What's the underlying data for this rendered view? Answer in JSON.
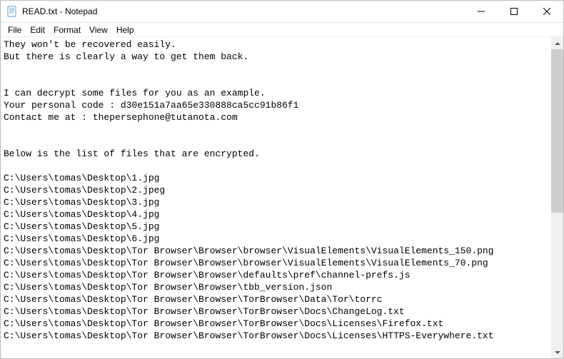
{
  "window": {
    "title": "READ.txt - Notepad"
  },
  "menubar": {
    "file": "File",
    "edit": "Edit",
    "format": "Format",
    "view": "View",
    "help": "Help"
  },
  "content": {
    "text": "They won't be recovered easily.\nBut there is clearly a way to get them back.\n\n\nI can decrypt some files for you as an example.\nYour personal code : d30e151a7aa65e330888ca5cc91b86f1\nContact me at : thepersephone@tutanota.com\n\n\nBelow is the list of files that are encrypted.\n\nC:\\Users\\tomas\\Desktop\\1.jpg\nC:\\Users\\tomas\\Desktop\\2.jpeg\nC:\\Users\\tomas\\Desktop\\3.jpg\nC:\\Users\\tomas\\Desktop\\4.jpg\nC:\\Users\\tomas\\Desktop\\5.jpg\nC:\\Users\\tomas\\Desktop\\6.jpg\nC:\\Users\\tomas\\Desktop\\Tor Browser\\Browser\\browser\\VisualElements\\VisualElements_150.png\nC:\\Users\\tomas\\Desktop\\Tor Browser\\Browser\\browser\\VisualElements\\VisualElements_70.png\nC:\\Users\\tomas\\Desktop\\Tor Browser\\Browser\\defaults\\pref\\channel-prefs.js\nC:\\Users\\tomas\\Desktop\\Tor Browser\\Browser\\tbb_version.json\nC:\\Users\\tomas\\Desktop\\Tor Browser\\Browser\\TorBrowser\\Data\\Tor\\torrc\nC:\\Users\\tomas\\Desktop\\Tor Browser\\Browser\\TorBrowser\\Docs\\ChangeLog.txt\nC:\\Users\\tomas\\Desktop\\Tor Browser\\Browser\\TorBrowser\\Docs\\Licenses\\Firefox.txt\nC:\\Users\\tomas\\Desktop\\Tor Browser\\Browser\\TorBrowser\\Docs\\Licenses\\HTTPS-Everywhere.txt"
  }
}
